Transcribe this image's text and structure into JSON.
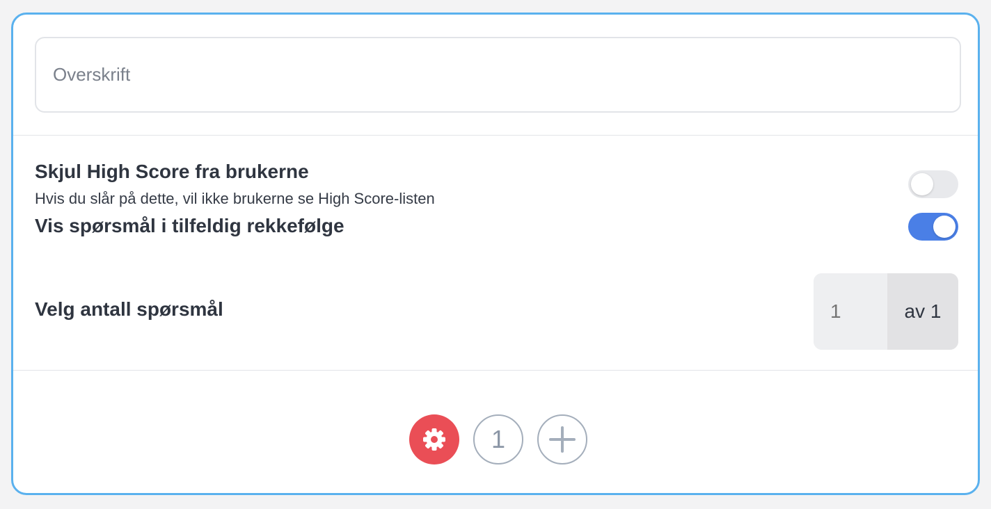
{
  "title_field": {
    "placeholder": "Overskrift",
    "value": ""
  },
  "settings": {
    "hide_highscore": {
      "title": "Skjul High Score fra brukerne",
      "description": "Hvis du slår på dette, vil ikke brukerne se High Score-listen",
      "enabled": false
    },
    "random_order": {
      "title": "Vis spørsmål i tilfeldig rekkefølge",
      "enabled": true
    },
    "question_count": {
      "label": "Velg antall spørsmål",
      "placeholder": "1",
      "suffix": "av 1"
    }
  },
  "nav": {
    "pages": [
      "1"
    ],
    "icons": [
      "gear-icon",
      "plus-icon"
    ]
  },
  "colors": {
    "card_border": "#5ab1ee",
    "toggle_on": "#4a7fe6",
    "settings_button": "#ea4e56"
  }
}
